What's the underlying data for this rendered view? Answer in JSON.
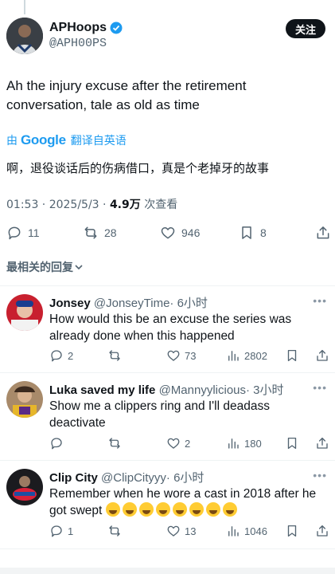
{
  "tweet": {
    "author_name": "APHoops",
    "author_handle": "@APH00PS",
    "follow_label": "关注",
    "text": "Ah the injury excuse after the retirement conversation, tale as old as time",
    "translate_prefix": "由",
    "translate_brand": "Google",
    "translate_label": "翻译自英语",
    "translated_text": "啊，退役谈话后的伤病借口，真是个老掉牙的故事",
    "time": "01:53 · 2025/5/3 · ",
    "views": "4.9万",
    "views_label": " 次查看",
    "replies": "11",
    "retweets": "28",
    "likes": "946",
    "bookmarks": "8"
  },
  "sort_label": "最相关的回复",
  "replies": [
    {
      "name": "Jonsey",
      "handle": "@JonseyTime",
      "time": "· 6小时",
      "text": "How would this be an excuse the series was already done when this happened",
      "replies": "2",
      "retweets": "",
      "likes": "73",
      "views": "2802"
    },
    {
      "name": "Luka saved my life",
      "handle": "@Mannyylicious",
      "time": "· 3小时",
      "text": "Show me a clippers ring and I'll deadass deactivate",
      "replies": "",
      "retweets": "",
      "likes": "2",
      "views": "180"
    },
    {
      "name": "Clip City",
      "handle": "@ClipCityyy",
      "time": "· 6小时",
      "text": "Remember when he wore a cast in 2018 after he got swept",
      "replies": "1",
      "retweets": "",
      "likes": "13",
      "views": "1046"
    }
  ],
  "colors": {
    "accent": "#1d9bf0",
    "muted": "#536471",
    "text": "#0f1419"
  }
}
